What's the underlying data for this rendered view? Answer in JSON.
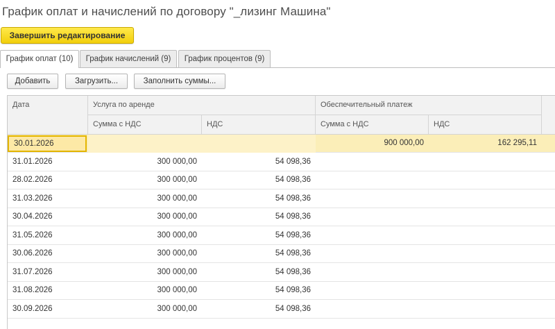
{
  "title": "График оплат и начислений по договору \"_лизинг Машина\"",
  "finish_button": "Завершить редактирование",
  "tabs": [
    {
      "label": "График оплат (10)",
      "active": true
    },
    {
      "label": "График начислений (9)",
      "active": false
    },
    {
      "label": "График процентов (9)",
      "active": false
    }
  ],
  "toolbar": {
    "add": "Добавить",
    "load": "Загрузить...",
    "fill": "Заполнить суммы..."
  },
  "table": {
    "headers": {
      "date": "Дата",
      "rent_group": "Услуга по аренде",
      "deposit_group": "Обеспечительный платеж",
      "rent_sum": "Сумма с НДС",
      "rent_vat": "НДС",
      "deposit_sum": "Сумма с НДС",
      "deposit_vat": "НДС"
    },
    "rows": [
      {
        "date": "30.01.2026",
        "rent_sum": "",
        "rent_vat": "",
        "deposit_sum": "900 000,00",
        "deposit_vat": "162 295,11"
      },
      {
        "date": "31.01.2026",
        "rent_sum": "300 000,00",
        "rent_vat": "54 098,36",
        "deposit_sum": "",
        "deposit_vat": ""
      },
      {
        "date": "28.02.2026",
        "rent_sum": "300 000,00",
        "rent_vat": "54 098,36",
        "deposit_sum": "",
        "deposit_vat": ""
      },
      {
        "date": "31.03.2026",
        "rent_sum": "300 000,00",
        "rent_vat": "54 098,36",
        "deposit_sum": "",
        "deposit_vat": ""
      },
      {
        "date": "30.04.2026",
        "rent_sum": "300 000,00",
        "rent_vat": "54 098,36",
        "deposit_sum": "",
        "deposit_vat": ""
      },
      {
        "date": "31.05.2026",
        "rent_sum": "300 000,00",
        "rent_vat": "54 098,36",
        "deposit_sum": "",
        "deposit_vat": ""
      },
      {
        "date": "30.06.2026",
        "rent_sum": "300 000,00",
        "rent_vat": "54 098,36",
        "deposit_sum": "",
        "deposit_vat": ""
      },
      {
        "date": "31.07.2026",
        "rent_sum": "300 000,00",
        "rent_vat": "54 098,36",
        "deposit_sum": "",
        "deposit_vat": ""
      },
      {
        "date": "31.08.2026",
        "rent_sum": "300 000,00",
        "rent_vat": "54 098,36",
        "deposit_sum": "",
        "deposit_vat": ""
      },
      {
        "date": "30.09.2026",
        "rent_sum": "300 000,00",
        "rent_vat": "54 098,36",
        "deposit_sum": "",
        "deposit_vat": ""
      }
    ]
  }
}
